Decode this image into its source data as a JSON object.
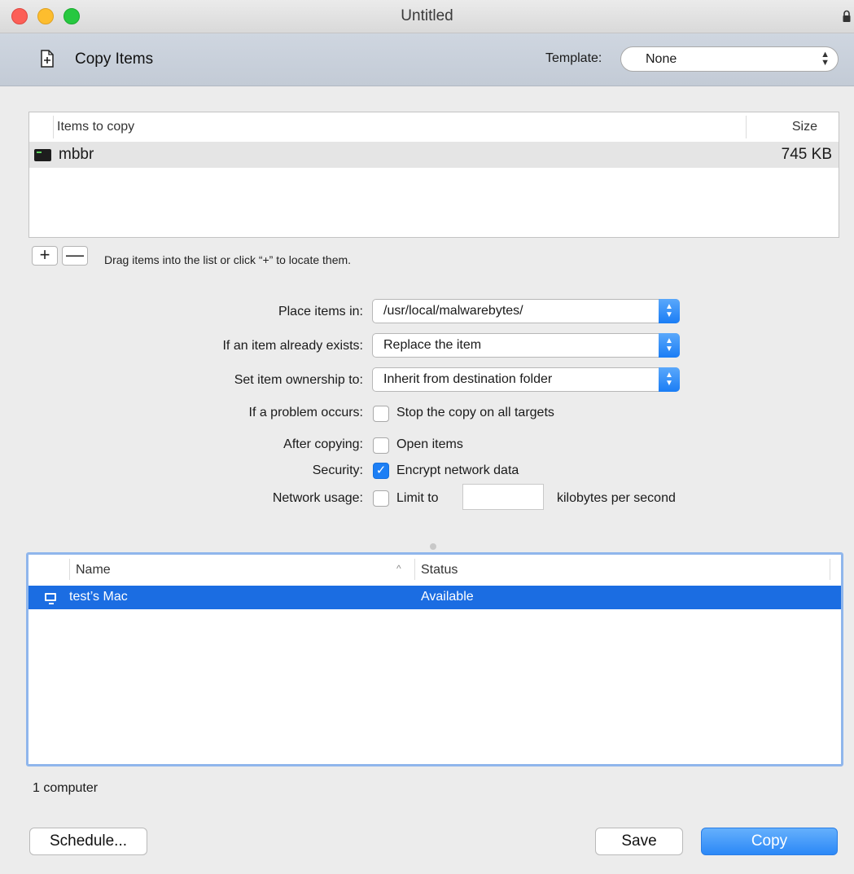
{
  "window": {
    "title": "Untitled"
  },
  "toolbar": {
    "task_title": "Copy Items",
    "template_label": "Template:",
    "template_value": "None"
  },
  "items_table": {
    "columns": [
      "Items to copy",
      "Size"
    ],
    "rows": [
      {
        "name": "mbbr",
        "size": "745 KB",
        "icon": "terminal-icon"
      }
    ]
  },
  "list_controls": {
    "add": "+",
    "remove": "—",
    "hint": "Drag items into the list or click “+” to locate them."
  },
  "options": {
    "place_label": "Place items in:",
    "place_value": "/usr/local/malwarebytes/",
    "exists_label": "If an item already exists:",
    "exists_value": "Replace the item",
    "ownership_label": "Set item ownership to:",
    "ownership_value": "Inherit from destination folder",
    "problem_label": "If a problem occurs:",
    "problem_option": "Stop the copy on all targets",
    "problem_checked": false,
    "after_label": "After copying:",
    "after_option": "Open items",
    "after_checked": false,
    "security_label": "Security:",
    "security_option": "Encrypt network data",
    "security_checked": true,
    "network_label": "Network usage:",
    "network_option": "Limit to",
    "network_checked": false,
    "network_rate_value": "",
    "network_unit": "kilobytes per second"
  },
  "computers_table": {
    "columns": [
      "Name",
      "Status"
    ],
    "sort_indicator": "^",
    "rows": [
      {
        "name": "test’s Mac",
        "status": "Available",
        "icon": "monitor-icon",
        "selected": true
      }
    ],
    "selection_color": "#1b6de2"
  },
  "footer": {
    "count": "1 computer",
    "schedule": "Schedule...",
    "save": "Save",
    "copy": "Copy"
  },
  "colors": {
    "accent": "#2b88f7",
    "close": "#fc5f57",
    "minimize": "#fdbd2e",
    "zoom": "#27c840"
  }
}
